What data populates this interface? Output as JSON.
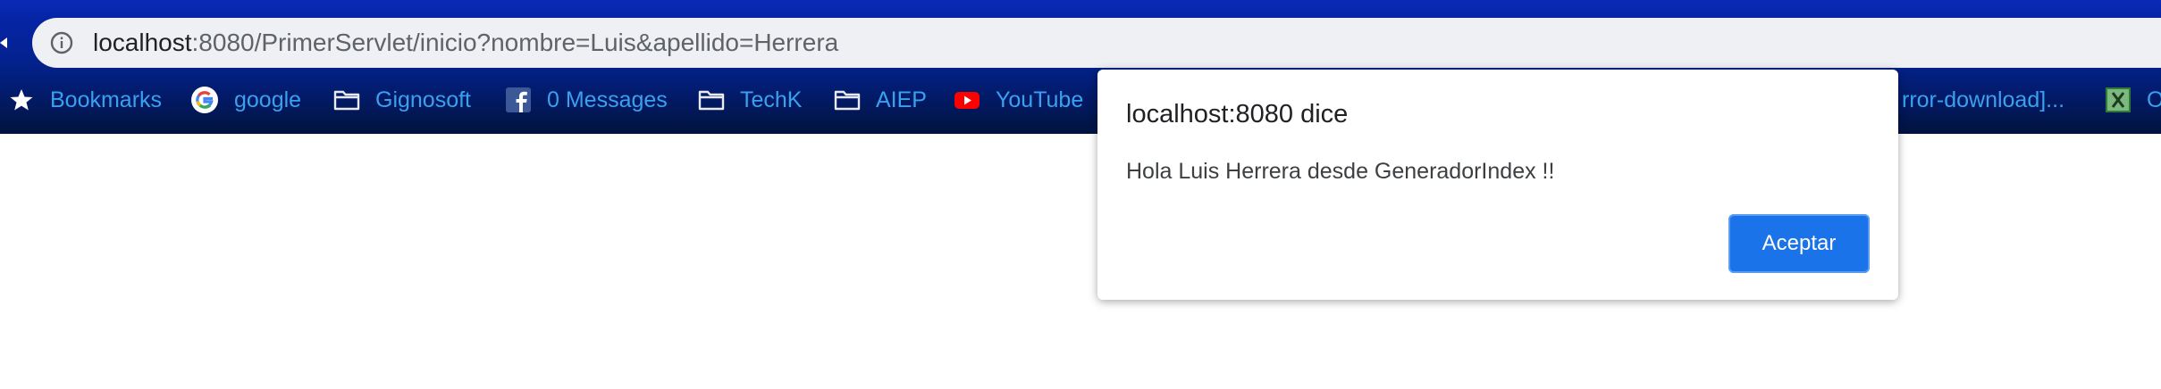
{
  "address_bar": {
    "host": "localhost",
    "rest": ":8080/PrimerServlet/inicio?nombre=Luis&apellido=Herrera"
  },
  "bookmarks": {
    "bookmarks_label": "Bookmarks",
    "google": "google",
    "gignosoft": "Gignosoft",
    "messages": "0 Messages",
    "techk": "TechK",
    "aiep": "AIEP",
    "youtube": "YouTube",
    "truncated": "rror-download]...",
    "last_partial": "O"
  },
  "dialog": {
    "title": "localhost:8080 dice",
    "message": "Hola Luis Herrera desde GeneradorIndex !!",
    "accept_label": "Aceptar"
  },
  "colors": {
    "accent": "#1a73e8",
    "bookmark_text": "#3aa0f0",
    "chrome_top": "#0a2bb8"
  }
}
